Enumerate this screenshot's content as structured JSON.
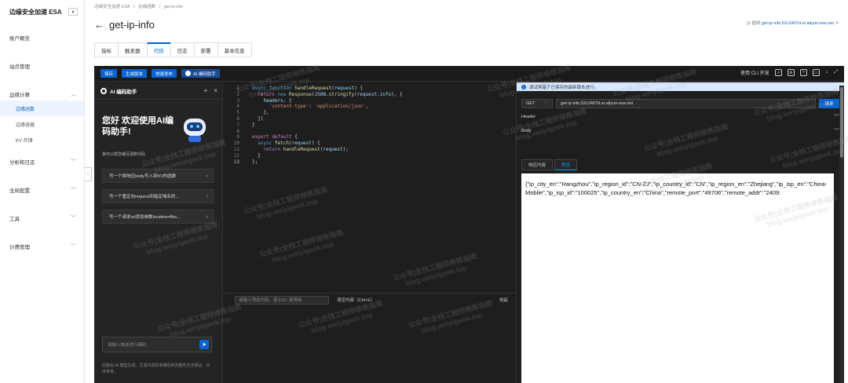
{
  "nav": {
    "brand": "边缘安全加速 ESA",
    "toggle": "▾",
    "items": [
      {
        "label": "账户概览"
      },
      {
        "label": "站点管理"
      },
      {
        "label": "边缘计算",
        "expanded": true
      },
      {
        "label": "分析和日志"
      },
      {
        "label": "全局配置"
      },
      {
        "label": "工具"
      },
      {
        "label": "计费管理"
      }
    ],
    "subitems": [
      {
        "label": "边缘函数",
        "active": true
      },
      {
        "label": "边缘容器"
      },
      {
        "label": "KV 存储"
      }
    ]
  },
  "breadcrumb": [
    "边缘安全加速 ESA",
    "/",
    "边缘函数",
    "/",
    "get-ip-info"
  ],
  "page_title": "get-ip-info",
  "visit": {
    "prefix": "访问",
    "link": "get-ip-info.52c2407d.er.aliyun-esa.net"
  },
  "tabs": [
    {
      "label": "指标"
    },
    {
      "label": "触发器"
    },
    {
      "label": "代码",
      "active": true
    },
    {
      "label": "日志"
    },
    {
      "label": "部署"
    },
    {
      "label": "基本信息"
    }
  ],
  "toolbar": {
    "save": "保存",
    "build": "生成版本",
    "publish": "快速发布",
    "ai": "AI 编码助手",
    "cli": "使用 CLI 开发"
  },
  "ai": {
    "title": "AI 编码助手",
    "welcome": "您好 欢迎使用AI编码助手!",
    "desc": "我可以帮您编写函数代码",
    "suggestions": [
      "写一个将响应body写入到KV的函数",
      "写一个重定向request到指定域名的...",
      "写一个请求url添加参数location=Bei..."
    ],
    "input_placeholder": "请输入描述进行编码",
    "footer": "回答由 AI 模型生成，生成内容的准确性和完整性无法保证，仅供参考。"
  },
  "code": {
    "line_numbers": [
      "1",
      "2",
      "3",
      "4",
      "5",
      "6",
      "7",
      "8",
      "9",
      "10",
      "11",
      "12",
      "13"
    ]
  },
  "console": {
    "filter_placeholder": "请输入筛选内容，按 ESC 键清除",
    "clear": "清空内容（Ctrl+E）",
    "fold": "收起"
  },
  "preview": {
    "notice": "调试将基于已保存的最新版本进行。",
    "method": "GET",
    "url": "get-ip-info.52c2407d.er.aliyun-esa.net",
    "send": "请求",
    "header": "Header",
    "body": "Body",
    "resp_tabs": [
      "响应内容",
      "预览"
    ],
    "response": "{\"ip_city_en\":\"Hangzhou\",\"ip_region_id\":\"CN-ZJ\",\"ip_country_id\":\"CN\",\"ip_region_en\":\"Zhejiang\",\"ip_isp_en\":\"China-Mobile\",\"ip_isp_id\":\"100025\",\"ip_country_en\":\"China\",\"remote_port\":\"49706\",\"remote_addr\":\"2409:"
  },
  "watermark": [
    "公众号|全栈工程师修炼指南",
    "blog.weiyigeek.top"
  ],
  "colors": {
    "accent": "#0064c8",
    "button": "#0a64d2",
    "editor_bg": "#1e1e1e"
  }
}
